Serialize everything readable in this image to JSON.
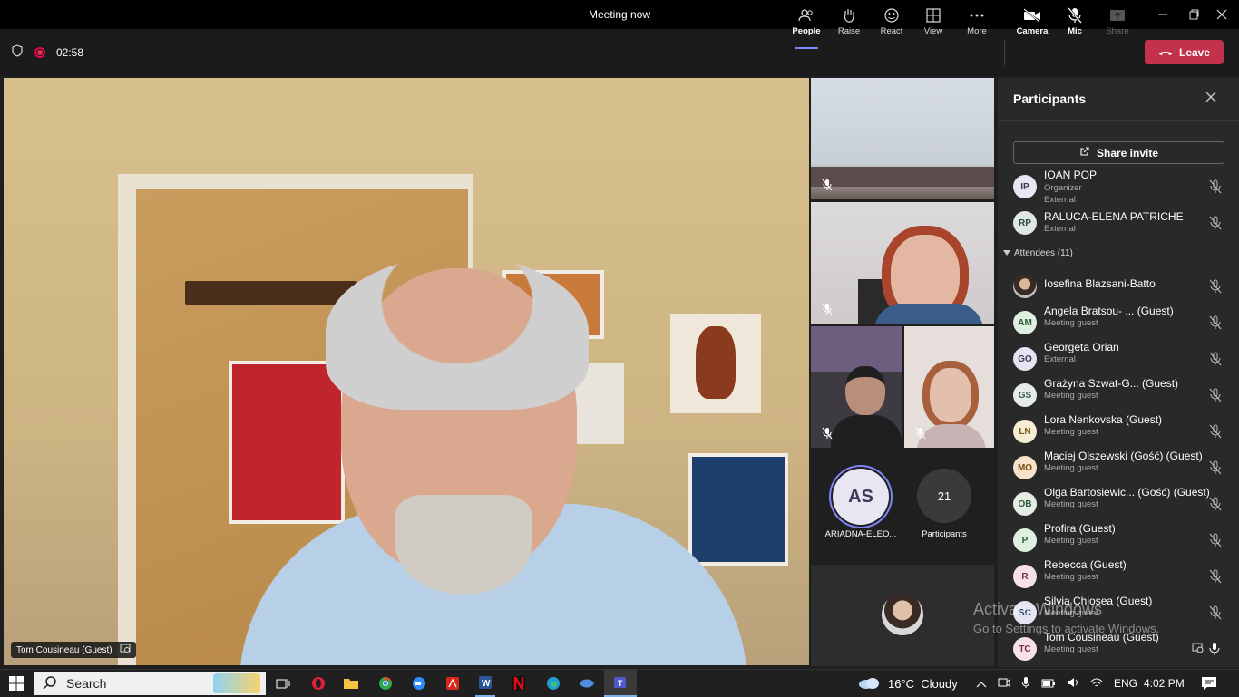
{
  "window": {
    "title": "Meeting now"
  },
  "toolbar": {
    "timer": "02:58",
    "people_label": "People",
    "raise_label": "Raise",
    "react_label": "React",
    "view_label": "View",
    "more_label": "More",
    "camera_label": "Camera",
    "mic_label": "Mic",
    "share_label": "Share",
    "leave_label": "Leave"
  },
  "main_video": {
    "name_tag": "Tom Cousineau (Guest)"
  },
  "gallery": {
    "as_initials": "AS",
    "as_name": "ARIADNA-ELEO...",
    "overflow_count": "21",
    "overflow_label": "Participants"
  },
  "panel": {
    "title": "Participants",
    "share_invite": "Share invite",
    "attendees_header": "Attendees (11)",
    "organizers": [
      {
        "initials": "IP",
        "name": "IOAN POP",
        "sub1": "Organizer",
        "sub2": "External"
      },
      {
        "initials": "RP",
        "name": "RALUCA-ELENA PATRICHE",
        "sub1": "External"
      }
    ],
    "attendees": [
      {
        "initials": "",
        "name": "Iosefina Blazsani-Batto",
        "sub": ""
      },
      {
        "initials": "AM",
        "name": "Angela Bratsou- ... (Guest)",
        "sub": "Meeting guest"
      },
      {
        "initials": "GO",
        "name": "Georgeta Orian",
        "sub": "External"
      },
      {
        "initials": "GS",
        "name": "Grażyna Szwat-G... (Guest)",
        "sub": "Meeting guest"
      },
      {
        "initials": "LN",
        "name": "Lora Nenkovska (Guest)",
        "sub": "Meeting guest"
      },
      {
        "initials": "MO",
        "name": "Maciej Olszewski (Gość) (Guest)",
        "sub": "Meeting guest"
      },
      {
        "initials": "OB",
        "name": "Olga Bartosiewic... (Gość) (Guest)",
        "sub": "Meeting guest"
      },
      {
        "initials": "P",
        "name": "Profira (Guest)",
        "sub": "Meeting guest"
      },
      {
        "initials": "R",
        "name": "Rebecca (Guest)",
        "sub": "Meeting guest"
      },
      {
        "initials": "SC",
        "name": "Silvia Chiosea (Guest)",
        "sub": "Meeting guest"
      },
      {
        "initials": "TC",
        "name": "Tom Cousineau (Guest)",
        "sub": "Meeting guest"
      }
    ]
  },
  "watermark": {
    "line1": "Activate Windows",
    "line2": "Go to Settings to activate Windows."
  },
  "taskbar": {
    "search": "Search",
    "weather": "16°C  Cloudy",
    "lang": "ENG",
    "time": "4:02 PM"
  },
  "colors": {
    "accent": "#7f85f5",
    "leave": "#c4314b",
    "avatar_bg": "#e8e6f2"
  }
}
